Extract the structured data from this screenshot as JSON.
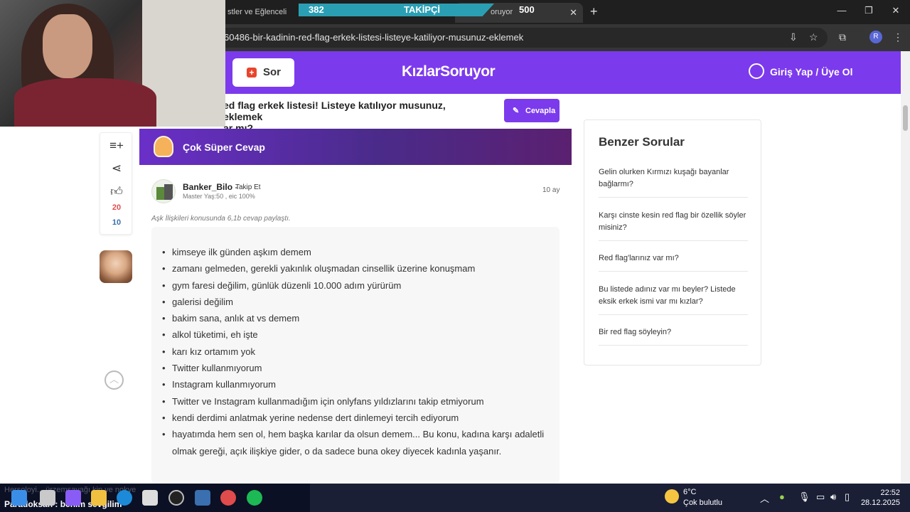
{
  "browser": {
    "tab1_title": "stler ve Eğlenceli",
    "tab2_title": "oruyor",
    "tab_close": "✕",
    "new_tab": "+",
    "url": "60486-bir-kadinin-red-flag-erkek-listesi-listeye-katiliyor-musunuz-eklemek",
    "profile_initial": "R"
  },
  "stream_overlay": {
    "follower_count": "382",
    "follower_label": "TAKİPÇİ",
    "follower_goal": "500",
    "progress": 0.764
  },
  "site": {
    "ask_button": "Sor",
    "logo": "KızlarSoruyor",
    "login_link": "Giriş Yap / Üye Ol",
    "question_title_line1": "ed flag erkek listesi! Listeye katılıyor musunuz, eklemek",
    "question_title_line2": "ar mı?",
    "answer_button": "Cevapla"
  },
  "rail": {
    "like_count": "20",
    "reply_count": "10"
  },
  "answer": {
    "badge": "Çok Süper Cevap",
    "username": "Banker_Bilo",
    "follow": "Takip Et",
    "level": "Master Yaş:50 , eic 100%",
    "time": "10 ay",
    "shared_note": "Aşk İlişkileri konusunda 6,1b cevap paylaştı.",
    "items": [
      "kimseye ilk günden aşkım demem",
      "zamanı gelmeden, gerekli yakınlık oluşmadan cinsellik üzerine konuşmam",
      "gym faresi değilim, günlük düzenli 10.000 adım yürürüm",
      "galerisi değilim",
      "bakim sana, anlık at vs demem",
      "alkol tüketimi, eh işte",
      "karı kız ortamım yok",
      "Twitter kullanmıyorum",
      "Instagram kullanmıyorum",
      "Twitter ve Instagram kullanmadığım için onlyfans yıldızlarını takip etmiyorum",
      "kendi derdimi anlatmak yerine nedense dert dinlemeyi tercih ediyorum",
      "hayatımda hem sen ol, hem başka karılar da olsun demem... Bu konu, kadına karşı adaletli olmak gereği, açık ilişkiye gider, o da sadece buna okey diyecek kadınla yaşanır."
    ]
  },
  "sidebar": {
    "title": "Benzer Sorular",
    "questions": [
      "Gelin olurken Kırmızı kuşağı bayanlar bağlarmı?",
      "Karşı cinste kesin red flag bir özellik söyler misiniz?",
      "Red flag'larınız var mı?",
      "Bu listede adınız var mı beyler? Listede eksik erkek ismi var mı kızlar?",
      "Bir red flag söyleyin?"
    ]
  },
  "taskbar": {
    "chat_ghost": "Hersoloyi... ürzemsayağı kip ve nokye",
    "chat_message": "Paradoksan : benim sevgilim",
    "temp": "6°C",
    "condition": "Çok bulutlu",
    "time": "22:52",
    "date": "28.12.2025"
  },
  "colors": {
    "brand": "#7c3aed",
    "like": "#e04b4b",
    "reply": "#3a6fb0"
  }
}
